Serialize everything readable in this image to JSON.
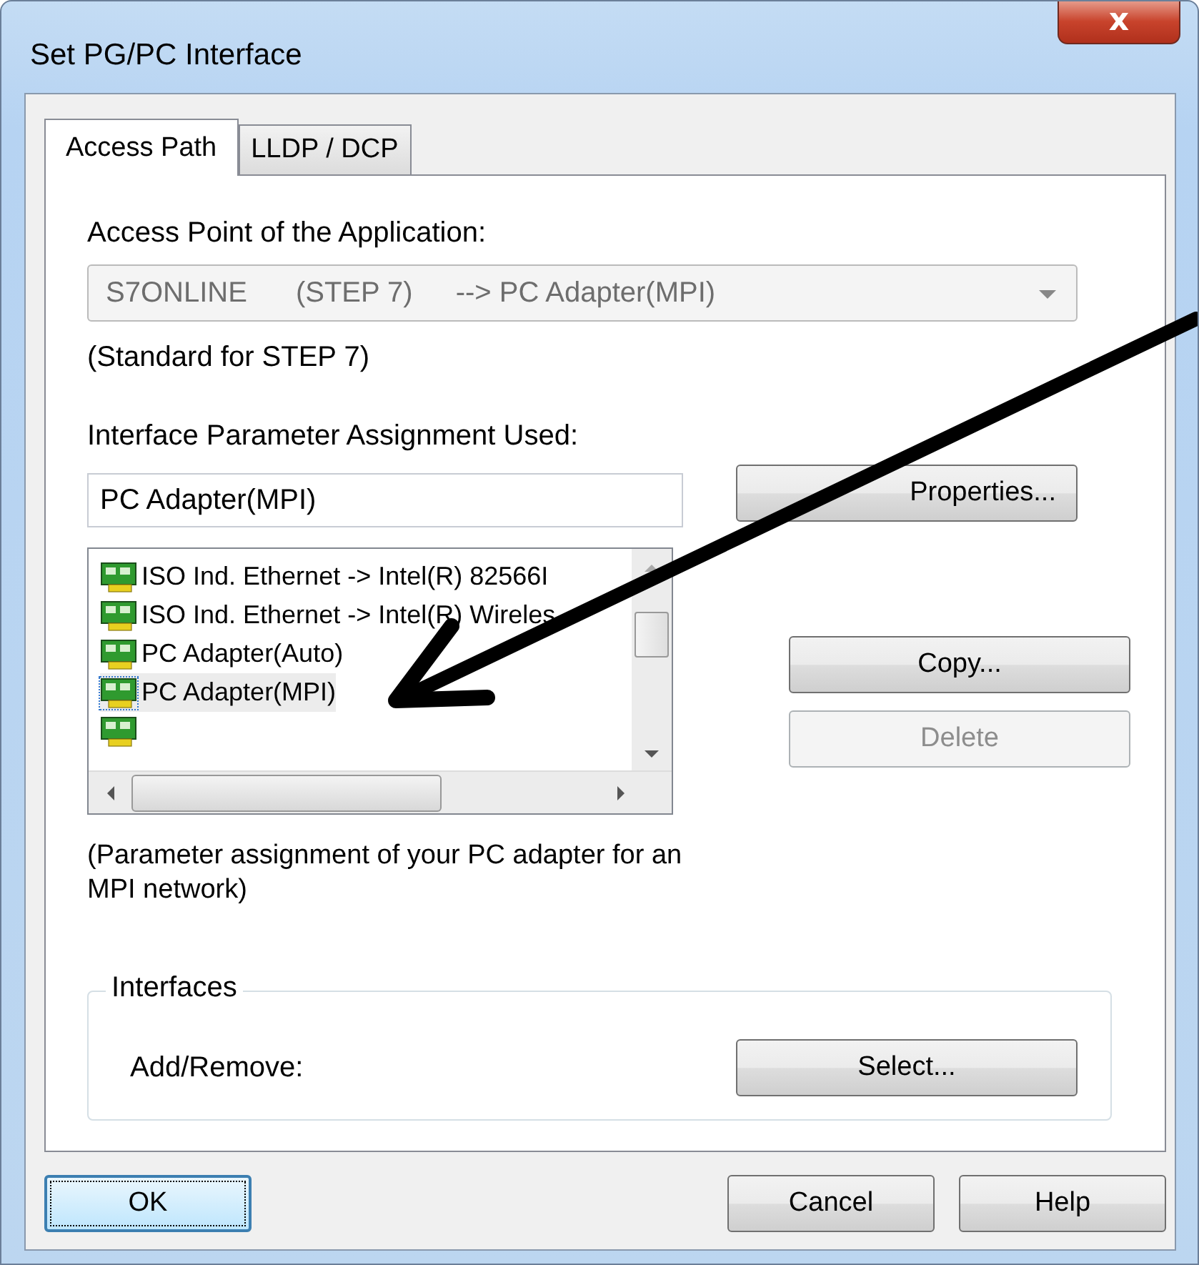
{
  "window": {
    "title": "Set PG/PC Interface",
    "close": "x"
  },
  "tabs": [
    {
      "label": "Access Path",
      "selected": true
    },
    {
      "label": "LLDP / DCP",
      "selected": false
    }
  ],
  "access_point": {
    "label": "Access Point of the Application:",
    "parts": [
      "S7ONLINE",
      "(STEP 7)",
      "--> PC Adapter(MPI)"
    ],
    "disabled": true
  },
  "standard_note": "(Standard for STEP 7)",
  "assignment": {
    "label": "Interface Parameter Assignment Used:",
    "value": "PC Adapter(MPI)"
  },
  "properties_button": {
    "label": "Properties...",
    "disabled": false
  },
  "interface_list": [
    {
      "label": "ISO Ind. Ethernet -> Intel(R) 82566I",
      "selected": false
    },
    {
      "label": "ISO Ind. Ethernet -> Intel(R) Wireles",
      "selected": false
    },
    {
      "label": "PC Adapter(Auto)",
      "selected": false
    },
    {
      "label": "PC Adapter(MPI)",
      "selected": true
    },
    {
      "selected": false
    }
  ],
  "list_buttons": [
    {
      "label": "Copy...",
      "disabled": false
    },
    {
      "label": "Delete",
      "disabled": true
    }
  ],
  "description": "(Parameter assignment of your PC adapter for an MPI network)",
  "interfaces_group": {
    "title": "Interfaces",
    "label": "Add/Remove:",
    "button": "Select..."
  },
  "footer_buttons": [
    {
      "label": "OK",
      "focused": true
    },
    {
      "label": "Cancel",
      "focused": false
    },
    {
      "label": "Help",
      "focused": false
    }
  ]
}
